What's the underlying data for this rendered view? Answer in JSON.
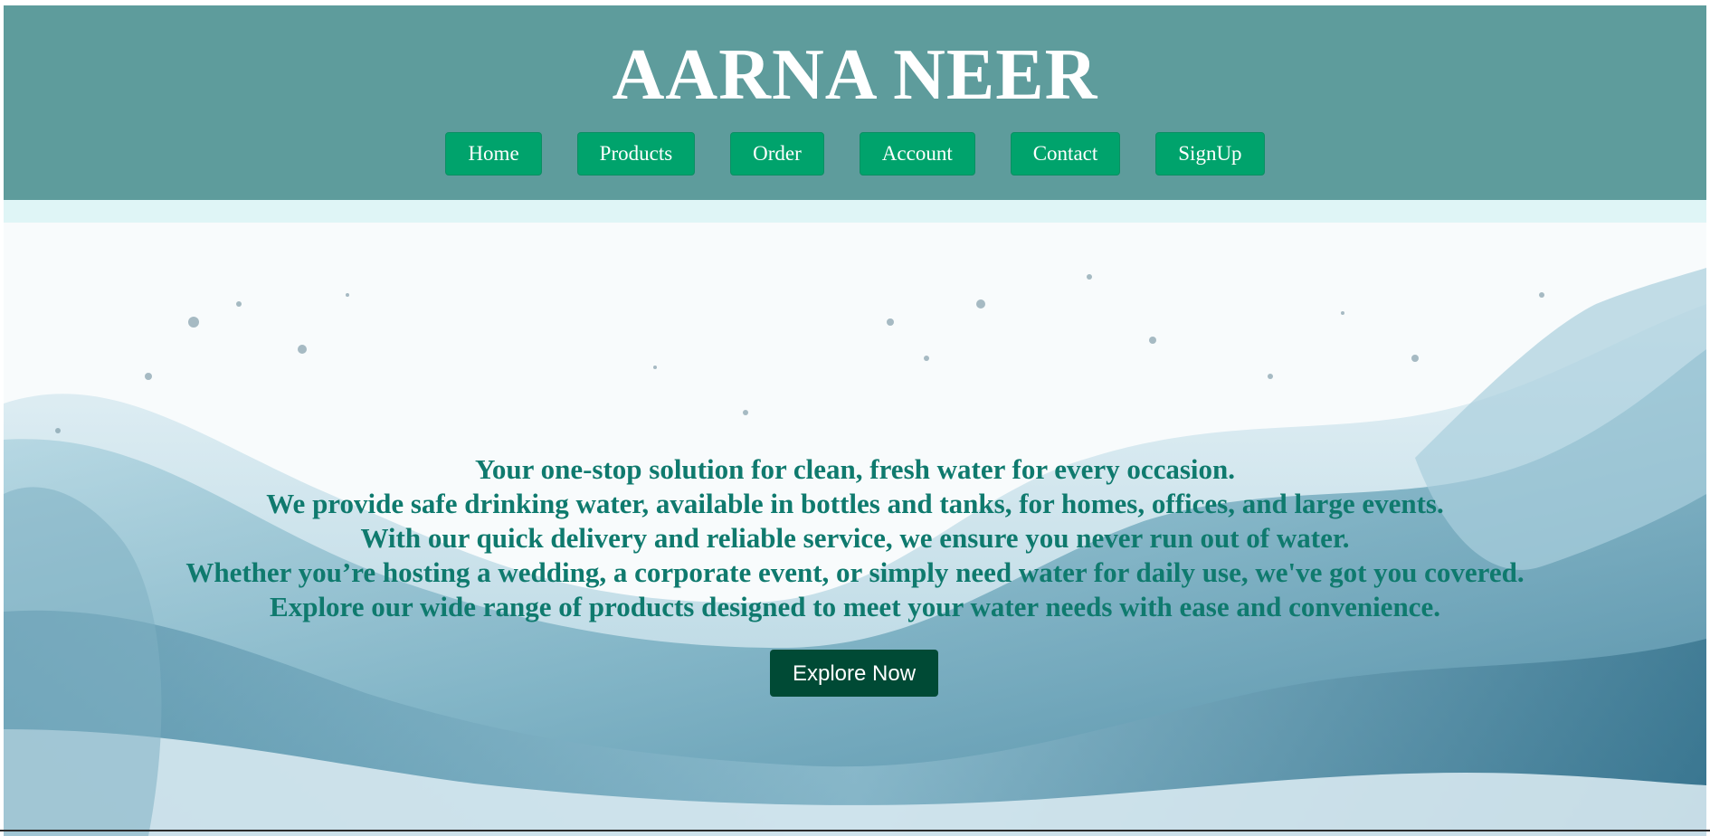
{
  "site": {
    "title": "AARNA NEER"
  },
  "nav": {
    "items": [
      {
        "label": "Home",
        "name": "nav-home-button"
      },
      {
        "label": "Products",
        "name": "nav-products-button"
      },
      {
        "label": "Order",
        "name": "nav-order-button"
      },
      {
        "label": "Account",
        "name": "nav-account-button"
      },
      {
        "label": "Contact",
        "name": "nav-contact-button"
      },
      {
        "label": "SignUp",
        "name": "nav-signup-button"
      }
    ]
  },
  "hero": {
    "lines": [
      "Your one-stop solution for clean, fresh water for every occasion.",
      "We provide safe drinking water, available in bottles and tanks, for homes, offices, and large events.",
      "With our quick delivery and reliable service, we ensure you never run out of water.",
      "Whether you’re hosting a wedding, a corporate event, or simply need water for daily use, we've got you covered.",
      "Explore our wide range of products designed to meet your water needs with ease and convenience."
    ],
    "cta_label": "Explore Now",
    "background_image": "water-splash"
  },
  "colors": {
    "header_bg": "#5e9c9c",
    "nav_button_bg": "#00a36c",
    "strip_bg": "#dff5f6",
    "hero_text": "#0f7a6e",
    "cta_bg": "#004a35"
  }
}
